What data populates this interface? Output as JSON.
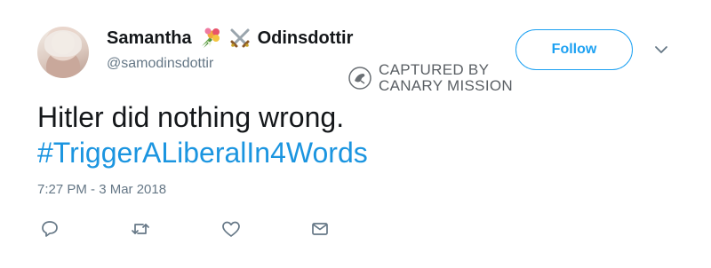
{
  "tweet": {
    "display_name_first": "Samantha",
    "display_name_last": "Odinsdottir",
    "name_emojis": [
      "bouquet-emoji",
      "crossed-swords-emoji"
    ],
    "handle": "@samodinsdottir",
    "text_line1": "Hitler did nothing wrong.",
    "hashtag": "#TriggerALiberalIn4Words",
    "timestamp": "7:27 PM - 3 Mar 2018"
  },
  "follow_button": {
    "label": "Follow"
  },
  "watermark": {
    "line1": "CAPTURED BY",
    "line2": "CANARY MISSION"
  },
  "actions": [
    "reply-icon",
    "retweet-icon",
    "like-icon",
    "direct-message-icon"
  ],
  "colors": {
    "accent": "#1da1f2",
    "link": "#1b95e0",
    "muted": "#657786",
    "text": "#14171a"
  }
}
